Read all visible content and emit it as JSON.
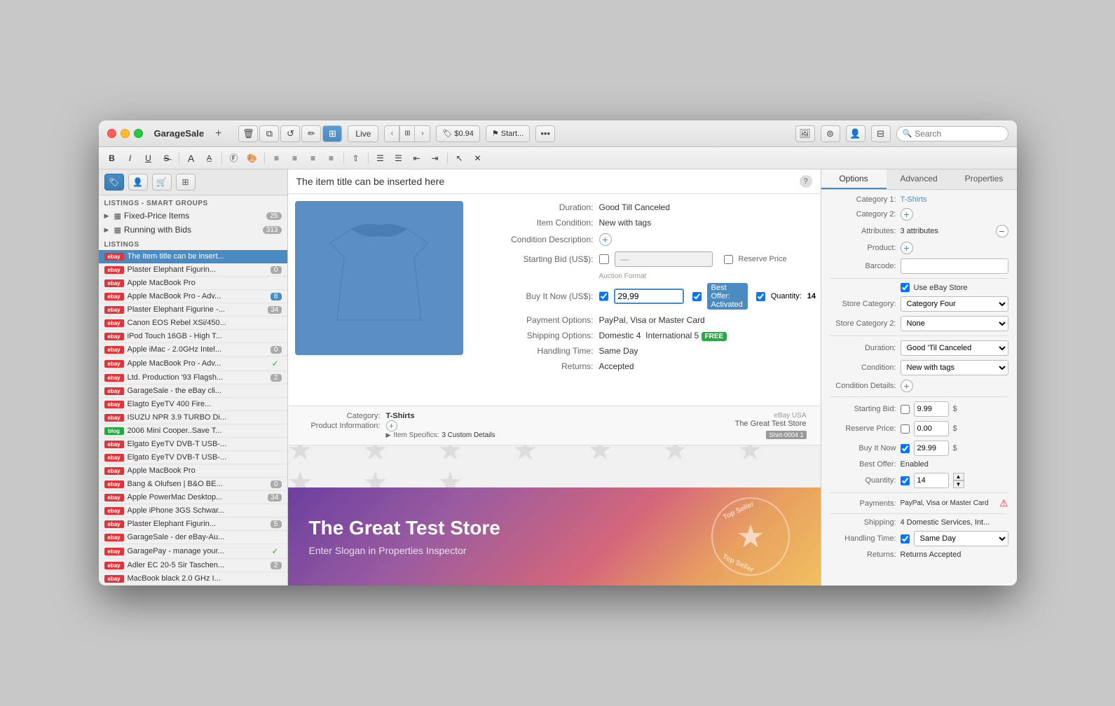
{
  "window": {
    "title": "GarageSale",
    "search_placeholder": "Search"
  },
  "toolbar": {
    "live_label": "Live",
    "price_label": "$0.94",
    "start_label": "Start...",
    "help_btn": "?",
    "dots_btn": "•••"
  },
  "sidebar": {
    "smart_groups_header": "LISTINGS - SMART GROUPS",
    "listings_header": "LISTINGS",
    "groups": [
      {
        "label": "Fixed-Price Items",
        "count": "25"
      },
      {
        "label": "Running with Bids",
        "count": "313"
      }
    ],
    "listings": [
      {
        "label": "The item title can be insert...",
        "badge": "ebay",
        "count": ""
      },
      {
        "label": "Plaster Elephant Figurin...",
        "badge": "ebay",
        "count": "0"
      },
      {
        "label": "Apple MacBook Pro",
        "badge": "ebay",
        "count": ""
      },
      {
        "label": "Apple MacBook Pro - Adv...",
        "badge": "ebay",
        "count": "8"
      },
      {
        "label": "Plaster Elephant Figurine -...",
        "badge": "ebay",
        "count": "34"
      },
      {
        "label": "Canon EOS Rebel XSi/450...",
        "badge": "ebay",
        "count": ""
      },
      {
        "label": "iPod Touch 16GB - High T...",
        "badge": "ebay",
        "count": ""
      },
      {
        "label": "Apple iMac - 2.0GHz Intel...",
        "badge": "ebay",
        "count": "0"
      },
      {
        "label": "Apple MacBook Pro - Adv...",
        "badge": "ebay",
        "count": "✓"
      },
      {
        "label": "Ltd. Production '93 Flagsh...",
        "badge": "ebay",
        "count": "2"
      },
      {
        "label": "GarageSale - the eBay cli...",
        "badge": "ebay",
        "count": ""
      },
      {
        "label": "Elagto EyeTV 400 Fire...",
        "badge": "ebay",
        "count": ""
      },
      {
        "label": "ISUZU NPR 3.9 TURBO Di...",
        "badge": "ebay",
        "count": ""
      },
      {
        "label": "2006 Mini Cooper..Save T...",
        "badge": "blog",
        "count": ""
      },
      {
        "label": "Elgato EyeTV DVB-T USB-...",
        "badge": "ebay",
        "count": ""
      },
      {
        "label": "Elgato EyeTV DVB-T USB-...",
        "badge": "ebay",
        "count": ""
      },
      {
        "label": "Apple MacBook Pro",
        "badge": "ebay",
        "count": ""
      },
      {
        "label": "Bang & Olufsen | B&O BE...",
        "badge": "ebay",
        "count": "0"
      },
      {
        "label": "Apple PowerMac Desktop...",
        "badge": "ebay",
        "count": "34"
      },
      {
        "label": "Apple iPhone 3GS Schwar...",
        "badge": "ebay",
        "count": ""
      },
      {
        "label": "Plaster Elephant Figurin...",
        "badge": "ebay",
        "count": "5"
      },
      {
        "label": "GarageSale - der eBay-Au...",
        "badge": "ebay",
        "count": ""
      },
      {
        "label": "GaragePay - manage your...",
        "badge": "ebay",
        "count": "✓"
      },
      {
        "label": "Adler EC 20-5 Sir Taschen...",
        "badge": "ebay",
        "count": "2"
      },
      {
        "label": "MacBook black 2.0 GHz I...",
        "badge": "ebay",
        "count": ""
      }
    ]
  },
  "listing_detail": {
    "title": "The item title can be inserted here",
    "duration_label": "Duration:",
    "duration_value": "Good Till Canceled",
    "condition_label": "Item Condition:",
    "condition_value": "New with tags",
    "condition_desc_label": "Condition Description:",
    "starting_bid_label": "Starting Bid (US$):",
    "starting_bid_value": "—",
    "reserve_price_label": "Reserve Price",
    "buy_now_label": "Buy It Now (US$):",
    "buy_now_value": "29,99",
    "best_offer_label": "Best Offer: Activated",
    "quantity_label": "Quantity:",
    "quantity_value": "14",
    "payment_label": "Payment Options:",
    "payment_value": "PayPal, Visa or Master Card",
    "shipping_label": "Shipping Options:",
    "shipping_value": "Domestic 4  International 5",
    "handling_label": "Handling Time:",
    "handling_value": "Same Day",
    "returns_label": "Returns:",
    "returns_value": "Accepted",
    "category_label": "Category:",
    "category_value": "T-Shirts",
    "product_info_label": "Product Information:",
    "item_specifics_label": "Item Specifics:",
    "item_specifics_value": "3 Custom Details",
    "ebay_usa": "eBay USA",
    "store_name": "The Great Test Store",
    "shirt_tag": "Shirt-0004 1",
    "free_badge": "FREE",
    "auction_format": "Auction Format"
  },
  "banner": {
    "title": "The Great Test Store",
    "subtitle": "Enter Slogan in Properties Inspector",
    "top_seller": "Top Seller"
  },
  "right_panel": {
    "tabs": [
      "Options",
      "Advanced",
      "Properties"
    ],
    "active_tab": "Options",
    "category1_label": "Category 1:",
    "category1_value": "T-Shirts",
    "category2_label": "Category 2:",
    "attributes_label": "Attributes:",
    "attributes_value": "3 attributes",
    "product_label": "Product:",
    "barcode_label": "Barcode:",
    "use_store_label": "Use eBay Store",
    "store_cat_label": "Store Category:",
    "store_cat_value": "Category Four",
    "store_cat2_label": "Store Category 2:",
    "store_cat2_value": "None",
    "duration_label": "Duration:",
    "duration_value": "Good 'Til Canceled",
    "condition_label": "Condition:",
    "condition_value": "New with tags",
    "cond_details_label": "Condition Details:",
    "starting_bid_label": "Starting Bid:",
    "starting_bid_value": "9.99",
    "reserve_label": "Reserve Price:",
    "reserve_value": "0.00",
    "buy_now_label": "Buy It Now",
    "buy_now_value": "29.99",
    "best_offer_label": "Best Offer:",
    "best_offer_value": "Enabled",
    "quantity_label": "Quantity:",
    "quantity_value": "14",
    "payments_label": "Payments:",
    "payments_value": "PayPal, Visa or Master Card",
    "shipping_label": "Shipping:",
    "shipping_value": "4 Domestic Services, Int...",
    "handling_label": "Handling Time:",
    "handling_value": "Same Day",
    "returns_label": "Returns:",
    "returns_value": "Returns Accepted"
  },
  "icons": {
    "close": "×",
    "arrow_left": "‹",
    "arrow_right": "›",
    "grid": "⊞",
    "trash": "🗑",
    "copy": "⧉",
    "refresh": "↺",
    "pencil": "✏",
    "photo": "🖼",
    "question": "?",
    "search": "🔍",
    "bold": "B",
    "italic": "I",
    "underline": "U",
    "strikethrough": "S",
    "font_size": "A",
    "font_color": "A",
    "paint": "🎨",
    "align_left": "≡",
    "align_center": "≡",
    "align_right": "≡",
    "justify": "≡",
    "indent_dec": "⇤",
    "indent_inc": "⇥",
    "list_ul": "☰",
    "list_ol": "☰",
    "link": "🔗",
    "cursor": "↖",
    "clear": "✕",
    "tag": "🏷",
    "person": "👤",
    "window": "⊟",
    "plus": "+",
    "minus": "−",
    "star": "★"
  }
}
